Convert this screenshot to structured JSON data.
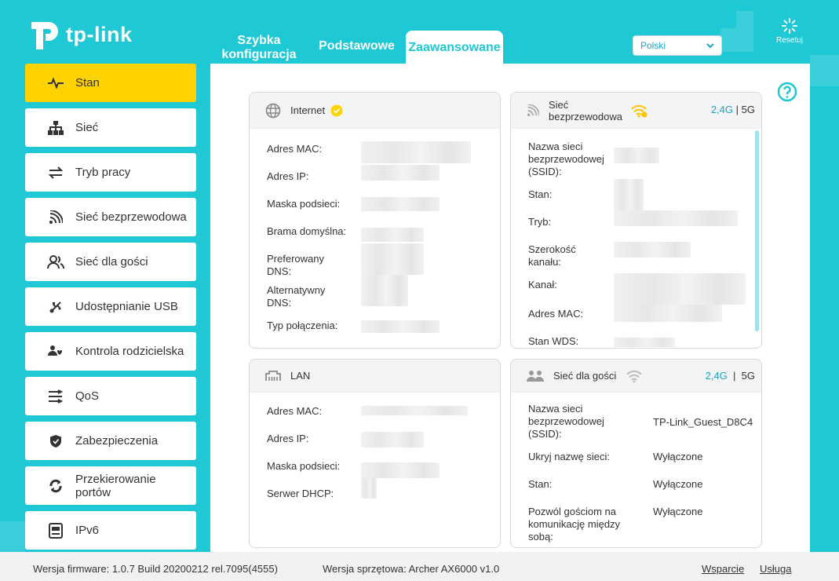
{
  "brand": {
    "name": "tp-link"
  },
  "tabs": [
    {
      "label": "Szybka konfiguracja"
    },
    {
      "label": "Podstawowe"
    },
    {
      "label": "Zaawansowane"
    }
  ],
  "language": {
    "selected": "Polski"
  },
  "reset": {
    "label": "Resetuj"
  },
  "sidebar": {
    "items": [
      {
        "label": "Stan",
        "icon": "pulse-icon",
        "active": true
      },
      {
        "label": "Sieć",
        "icon": "network-icon"
      },
      {
        "label": "Tryb pracy",
        "icon": "mode-icon"
      },
      {
        "label": "Sieć bezprzewodowa",
        "icon": "wireless-icon"
      },
      {
        "label": "Sieć dla gości",
        "icon": "guest-icon"
      },
      {
        "label": "Udostępnianie USB",
        "icon": "usb-icon"
      },
      {
        "label": "Kontrola rodzicielska",
        "icon": "parental-icon"
      },
      {
        "label": "QoS",
        "icon": "qos-icon"
      },
      {
        "label": "Zabezpieczenia",
        "icon": "shield-icon"
      },
      {
        "label": "Przekierowanie portów",
        "icon": "port-forward-icon"
      },
      {
        "label": "IPv6",
        "icon": "ipv6-icon"
      }
    ]
  },
  "internet": {
    "title": "Internet",
    "rows": [
      {
        "label": "Adres MAC:"
      },
      {
        "label": "Adres IP:"
      },
      {
        "label": "Maska podsieci:"
      },
      {
        "label": "Brama domyślna:"
      },
      {
        "label": "Preferowany DNS:"
      },
      {
        "label": "Alternatywny DNS:"
      },
      {
        "label": "Typ połączenia:"
      }
    ]
  },
  "wireless": {
    "title": "Sieć bezprzewodowa",
    "band_24": "2,4G",
    "band_sep": "|",
    "band_5": "5G",
    "rows": [
      {
        "label": "Nazwa sieci bezprzewodowej (SSID):"
      },
      {
        "label": "Stan:"
      },
      {
        "label": "Tryb:"
      },
      {
        "label": "Szerokość kanału:"
      },
      {
        "label": "Kanał:"
      },
      {
        "label": "Adres MAC:"
      },
      {
        "label": "Stan WDS:"
      }
    ]
  },
  "lan": {
    "title": "LAN",
    "rows": [
      {
        "label": "Adres MAC:"
      },
      {
        "label": "Adres IP:"
      },
      {
        "label": "Maska podsieci:"
      },
      {
        "label": "Serwer DHCP:"
      }
    ]
  },
  "guest": {
    "title": "Sieć dla gości",
    "band_24": "2,4G",
    "band_sep": "|",
    "band_5": "5G",
    "rows": [
      {
        "label": "Nazwa sieci bezprzewodowej (SSID):",
        "value": "TP-Link_Guest_D8C4"
      },
      {
        "label": "Ukryj nazwę sieci:",
        "value": "Wyłączone"
      },
      {
        "label": "Stan:",
        "value": "Wyłączone"
      },
      {
        "label": "Pozwól gościom na komunikację między sobą:",
        "value": "Wyłączone"
      }
    ]
  },
  "footer": {
    "firmware": "Wersja firmware: 1.0.7 Build 20200212 rel.7095(4555)",
    "hardware": "Wersja sprzętowa: Archer AX6000 v1.0",
    "support": "Wsparcie",
    "service": "Usługa"
  },
  "colors": {
    "accent": "#1ec8d4",
    "active": "#ffd200",
    "link": "#1ea4c8"
  }
}
